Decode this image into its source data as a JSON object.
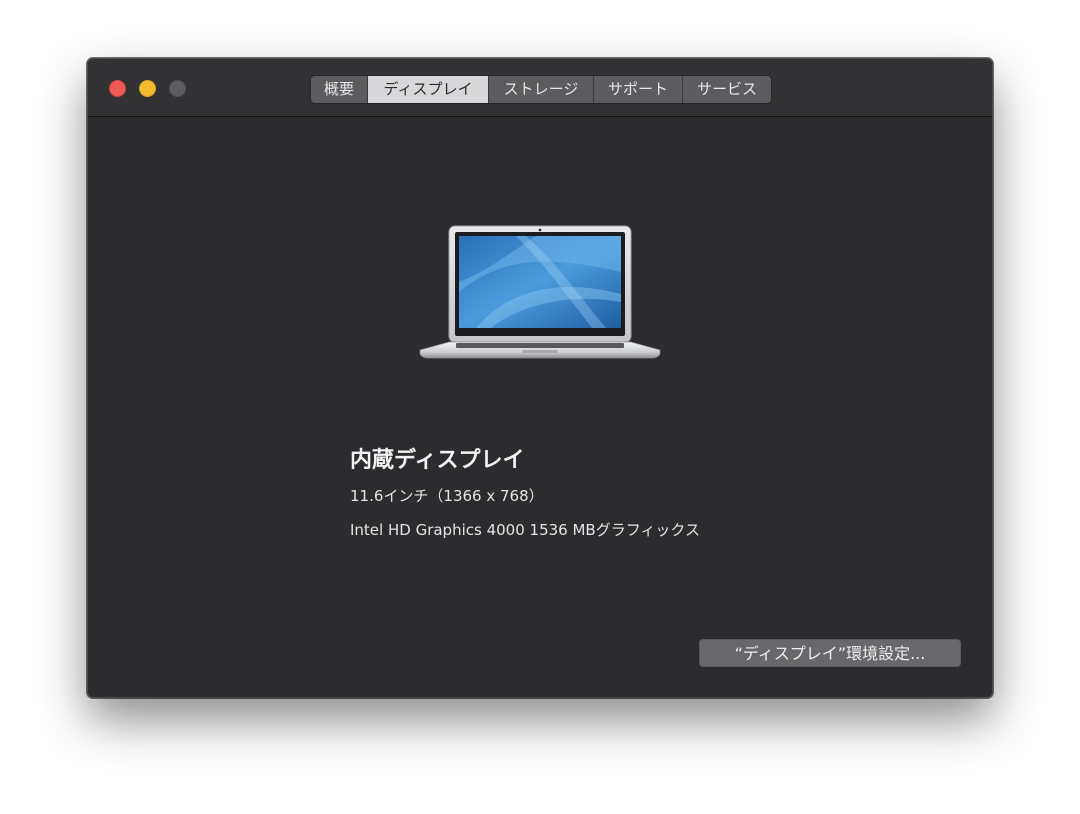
{
  "window": {
    "controls": {
      "close": "close-icon",
      "minimize": "minimize-icon",
      "zoom": "zoom-icon"
    }
  },
  "tabs": [
    {
      "label": "概要",
      "selected": false
    },
    {
      "label": "ディスプレイ",
      "selected": true
    },
    {
      "label": "ストレージ",
      "selected": false
    },
    {
      "label": "サポート",
      "selected": false
    },
    {
      "label": "サービス",
      "selected": false
    }
  ],
  "display": {
    "image": "macbook-air-icon",
    "title": "内蔵ディスプレイ",
    "size": "11.6インチ（1366 x 768）",
    "graphics": "Intel HD Graphics 4000 1536 MBグラフィックス"
  },
  "actions": {
    "display_prefs_label": "“ディスプレイ”環境設定..."
  },
  "colors": {
    "window_bg": "#2c2c2e",
    "close": "#ee5b56",
    "minimize": "#f2bc2f",
    "zoom_disabled": "#5d5d60",
    "tab_selected": "#d8d8da",
    "button": "#68686b"
  }
}
